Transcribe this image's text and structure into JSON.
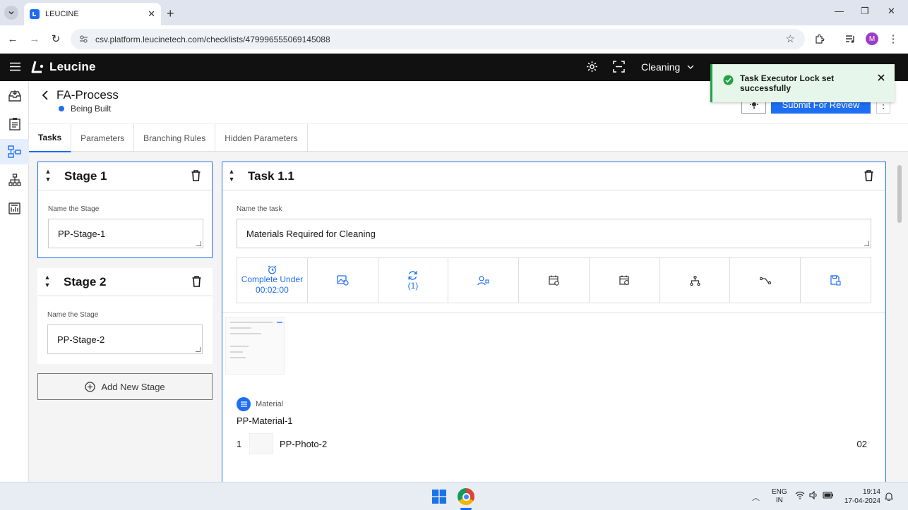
{
  "browser": {
    "tab_title": "LEUCINE",
    "url": "csv.platform.leucinetech.com/checklists/479996555069145088",
    "profile_initial": "M"
  },
  "header": {
    "brand": "Leucine",
    "facility": "Cleaning"
  },
  "page": {
    "title": "FA-Process",
    "status": "Being Built",
    "submit_label": "Submit For Review"
  },
  "tabs": [
    "Tasks",
    "Parameters",
    "Branching Rules",
    "Hidden Parameters"
  ],
  "stages": [
    {
      "title": "Stage 1",
      "field_label": "Name the Stage",
      "value": "PP-Stage-1"
    },
    {
      "title": "Stage 2",
      "field_label": "Name the Stage",
      "value": "PP-Stage-2"
    }
  ],
  "add_stage_label": "Add New Stage",
  "task": {
    "title": "Task 1.1",
    "field_label": "Name the task",
    "value": "Materials Required for Cleaning",
    "timer_line1": "Complete Under",
    "timer_line2": "00:02:00",
    "recurrence_count": "(1)",
    "material_section_label": "Material",
    "material_name": "PP-Material-1",
    "material_row": {
      "index": "1",
      "name": "PP-Photo-2",
      "quantity": "02"
    }
  },
  "toast": {
    "message": "Task Executor Lock set successfully"
  },
  "taskbar": {
    "lang_line1": "ENG",
    "lang_line2": "IN",
    "time": "19:14",
    "date": "17-04-2024"
  },
  "colors": {
    "accent": "#1d6ef2",
    "header_bg": "#111111",
    "success": "#24a148",
    "toast_bg": "#e6f6ea"
  }
}
